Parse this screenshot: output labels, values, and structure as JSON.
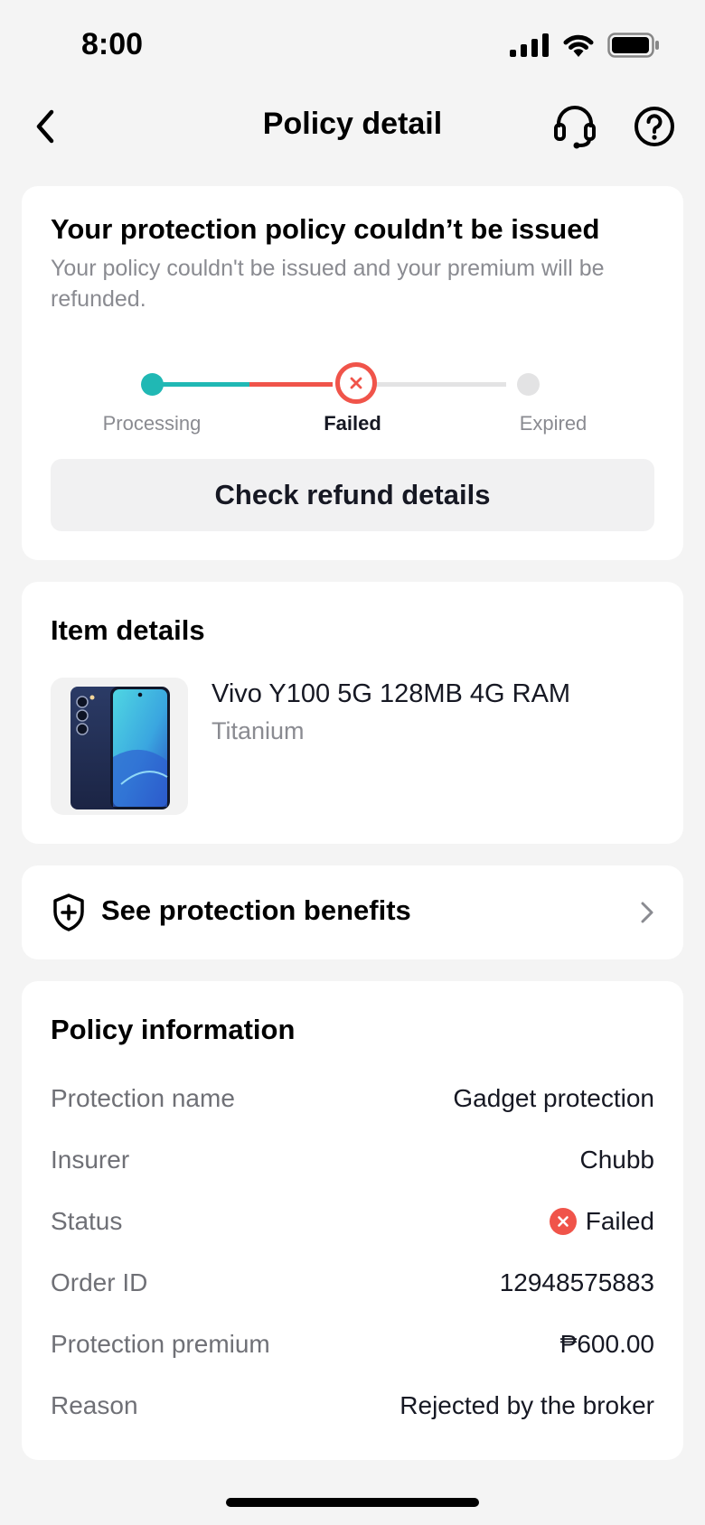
{
  "status_bar": {
    "time": "8:00"
  },
  "nav": {
    "title": "Policy detail"
  },
  "status_card": {
    "title": "Your protection policy couldn’t be issued",
    "description": "Your policy couldn't be issued and your premium will be refunded.",
    "steps": [
      {
        "label": "Processing",
        "state": "done"
      },
      {
        "label": "Failed",
        "state": "failed"
      },
      {
        "label": "Expired",
        "state": "pending"
      }
    ],
    "refund_button": "Check refund details"
  },
  "item_card": {
    "title": "Item details",
    "item_name": "Vivo Y100 5G 128MB 4G RAM",
    "item_variant": "Titanium"
  },
  "benefits": {
    "label": "See protection benefits"
  },
  "policy": {
    "title": "Policy information",
    "rows": [
      {
        "label": "Protection name",
        "value": "Gadget protection"
      },
      {
        "label": "Insurer",
        "value": "Chubb"
      },
      {
        "label": "Status",
        "value": "Failed"
      },
      {
        "label": "Order ID",
        "value": "12948575883"
      },
      {
        "label": "Protection premium",
        "value": "₱600.00"
      },
      {
        "label": "Reason",
        "value": "Rejected by the broker"
      }
    ]
  },
  "colors": {
    "accent_teal": "#20b8b4",
    "error_red": "#f0544a",
    "background": "#f4f4f4"
  }
}
